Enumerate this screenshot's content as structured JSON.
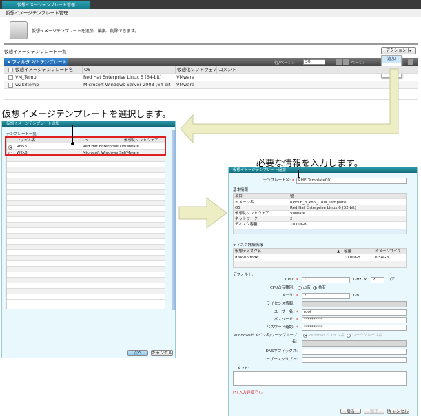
{
  "main_window": {
    "tab_title": "仮想イメージテンプレート管理",
    "breadcrumb": "仮想イメージテンプレート管理",
    "description": "仮想イメージテンプレートを追加、編集、削除できます。",
    "list_title": "仮想イメージテンプレート一覧",
    "action_button": "アクション",
    "action_menu": [
      "追加"
    ],
    "filter_label": "フィルタ",
    "filter_count": "2/2 テンプレート",
    "rows_per_page_label": "行/ページ:",
    "rows_per_page_value": "50",
    "page_label": "ページ:",
    "columns": [
      "仮想イメージテンプレート名",
      "OS",
      "仮想化ソフトウェア",
      "コメント"
    ],
    "rows": [
      [
        "VM_Temp",
        "Red Hat Enterprise Linux 5 (64-bit)",
        "VMware",
        ""
      ],
      [
        "w2k8temp",
        "Microsoft Windows Server 2008 (64-bit",
        "VMware",
        ""
      ]
    ]
  },
  "caption_select": "仮想イメージテンプレートを選択します。",
  "caption_input": "必要な情報を入力します。",
  "select_dialog": {
    "title": "仮想イメージテンプレート追加",
    "list_label": "テンプレート一覧:",
    "columns": [
      "ファイル名",
      "OS",
      "仮想化ソフトウェア"
    ],
    "rows": [
      {
        "name": "RH53",
        "os": "Red Hat Enterprise Lin",
        "software": "VMware",
        "selected": true
      },
      {
        "name": "W2k8",
        "os": "Microsoft Windows Ser",
        "software": "VMware",
        "selected": false
      }
    ],
    "next_button": "次へ",
    "cancel_button": "キャンセル"
  },
  "input_dialog": {
    "title": "仮想イメージテンプレート追加",
    "template_name_label": "テンプレート名:",
    "template_name_value": "RHELTemplate001",
    "basic_info_label": "基本情報",
    "basic_columns": [
      "項目",
      "値"
    ],
    "basic_rows": [
      [
        "イメージ名",
        "RHEL6_3_x86_ITRM_Template"
      ],
      [
        "OS",
        "Red Hat Enterprise Linux 6 (32-bit)"
      ],
      [
        "仮想化ソフトウェア",
        "VMware"
      ],
      [
        "ネットワーク",
        "2"
      ],
      [
        "ディスク容量",
        "10.00GB"
      ]
    ],
    "disk_info_label": "ディスク詳細情報",
    "disk_columns": [
      "仮想ディスク名",
      "容量",
      "イメージサイズ"
    ],
    "disk_rows": [
      [
        "disk-0.vmdk",
        "10.00GB",
        "0.54GB"
      ]
    ],
    "default_label": "デフォルト:",
    "cpu_label": "CPU:",
    "cpu_value": "1",
    "cpu_unit": "GHz",
    "times": "×",
    "core_value": "2",
    "core_unit": "コア",
    "cpu_share_label": "CPU占有種別:",
    "cpu_share_options": [
      "占有",
      "共有"
    ],
    "cpu_share_selected": "共有",
    "memory_label": "メモリ:",
    "memory_value": "2",
    "memory_unit": "GB",
    "license_label": "ライセンス情報:",
    "user_label": "ユーザー名:",
    "user_value": "root",
    "password_label": "パスワード:",
    "password_value": "**********",
    "password_confirm_label": "パスワード確認:",
    "password_confirm_value": "**********",
    "domain_label": "Windowsドメイン名/ワークグループ名:",
    "domain_options": [
      "Windowsドメイン名",
      "ワークグループ名"
    ],
    "dns_label": "DNSサフィックス:",
    "user_script_label": "ユーザースクリプト:",
    "comment_label": "コメント:",
    "required_note": "(*) 入力必須です。",
    "back_button": "戻る",
    "finish_button": "完了",
    "cancel_button": "キャンセル"
  },
  "colors": {
    "arrow": "#eeeec4",
    "highlight_box": "#e02020",
    "dialog_title": "#1a7f8f"
  }
}
